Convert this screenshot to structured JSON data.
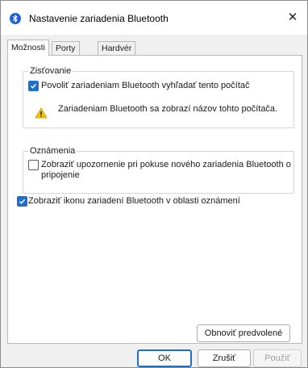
{
  "window": {
    "title": "Nastavenie zariadenia Bluetooth",
    "close_glyph": "✕"
  },
  "tabs": [
    {
      "label": "Možnosti",
      "active": true
    },
    {
      "label": "Porty COM",
      "active": false
    },
    {
      "label": "Hardvér",
      "active": false
    }
  ],
  "discovery": {
    "group_label": "Zisťovanie",
    "allow_find_label": "Povoliť zariadeniam Bluetooth vyhľadať tento počítač",
    "allow_find_checked": true,
    "warning_text": "Zariadeniam Bluetooth sa zobrazí názov tohto počítača."
  },
  "notifications": {
    "group_label": "Oznámenia",
    "alert_label_line1": "Zobraziť upozornenie pri pokuse nového zariadenia Bluetooth o",
    "alert_label_line2": "pripojenie",
    "alert_checked": false
  },
  "tray_icon": {
    "label": "Zobraziť ikonu zariadení Bluetooth v oblasti oznámení",
    "checked": true
  },
  "buttons": {
    "restore_defaults": "Obnoviť predvolené",
    "ok": "OK",
    "cancel": "Zrušiť",
    "apply": "Použiť"
  },
  "colors": {
    "accent": "#1f6fd1",
    "warning": "#f2c200"
  },
  "icons": {
    "app": "bluetooth-icon",
    "close": "close-icon",
    "warning": "warning-icon",
    "checkmark": "checkmark-icon"
  }
}
